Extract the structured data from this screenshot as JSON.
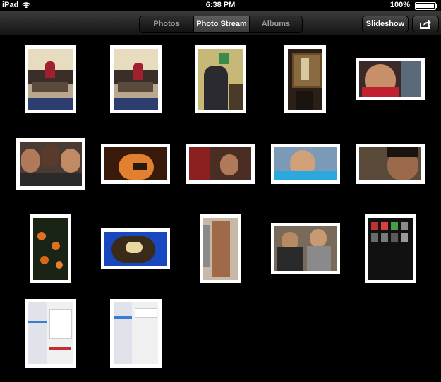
{
  "status_bar": {
    "device": "iPad",
    "time": "6:38 PM",
    "battery": "100%"
  },
  "segmented": {
    "photos": "Photos",
    "photo_stream": "Photo Stream",
    "albums": "Albums",
    "selected": "Photo Stream"
  },
  "toolbar": {
    "slideshow": "Slideshow",
    "share_icon": "share-icon"
  },
  "colors": {
    "background": "#000000",
    "navbar": "#2a2a2a",
    "thumb_border": "#ffffff"
  },
  "photos": [
    {
      "row": 1,
      "col": 1,
      "subject": "family-room"
    },
    {
      "row": 1,
      "col": 2,
      "subject": "family-room"
    },
    {
      "row": 1,
      "col": 3,
      "subject": "person-at-desk"
    },
    {
      "row": 1,
      "col": 4,
      "subject": "painting"
    },
    {
      "row": 1,
      "col": 5,
      "subject": "child-face"
    },
    {
      "row": 2,
      "col": 1,
      "subject": "group-selfie"
    },
    {
      "row": 2,
      "col": 2,
      "subject": "pumpkin"
    },
    {
      "row": 2,
      "col": 3,
      "subject": "child-red"
    },
    {
      "row": 2,
      "col": 4,
      "subject": "child-blue"
    },
    {
      "row": 2,
      "col": 5,
      "subject": "child-closeup"
    },
    {
      "row": 3,
      "col": 1,
      "subject": "flowers"
    },
    {
      "row": 3,
      "col": 2,
      "subject": "tree-sky"
    },
    {
      "row": 3,
      "col": 3,
      "subject": "sculpture"
    },
    {
      "row": 3,
      "col": 4,
      "subject": "two-people"
    },
    {
      "row": 3,
      "col": 5,
      "subject": "app-screenshot"
    },
    {
      "row": 4,
      "col": 1,
      "subject": "settings-screenshot"
    },
    {
      "row": 4,
      "col": 2,
      "subject": "settings-screenshot"
    }
  ]
}
